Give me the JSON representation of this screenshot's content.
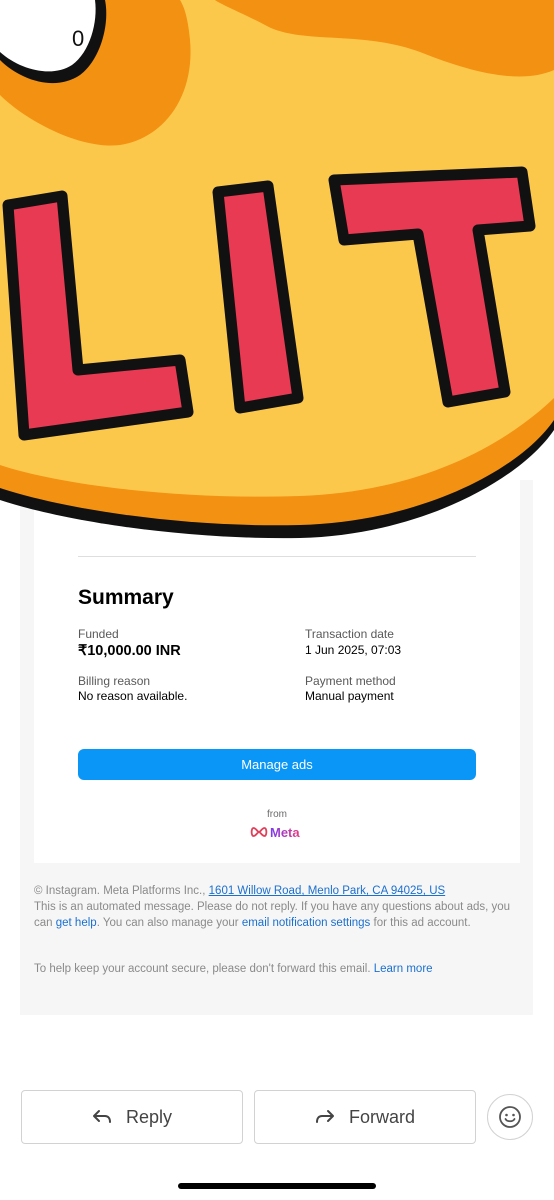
{
  "sticker": {
    "text": "LIT",
    "partial_text": "0"
  },
  "summary": {
    "title": "Summary",
    "funded_label": "Funded",
    "funded_value": "₹10,000.00 INR",
    "transaction_date_label": "Transaction date",
    "transaction_date_value": "1 Jun 2025, 07:03",
    "billing_reason_label": "Billing reason",
    "billing_reason_value": "No reason available.",
    "payment_method_label": "Payment method",
    "payment_method_value": "Manual payment"
  },
  "manage_ads_label": "Manage ads",
  "branding": {
    "from": "from",
    "logo_text": "Meta"
  },
  "footer": {
    "copyright": "© Instagram. Meta Platforms Inc.,",
    "address": "1601 Willow Road, Menlo Park, CA 94025, US",
    "automated_msg": "This is an automated message. Please do not reply. If you have any questions about ads, you can",
    "get_help": "get help",
    "manage_text": ". You can also manage your",
    "email_settings": "email notification settings",
    "ad_account_text": "for this ad account.",
    "secure_text": "To help keep your account secure, please don't forward this email.",
    "learn_more": "Learn more"
  },
  "actions": {
    "reply": "Reply",
    "forward": "Forward"
  },
  "colors": {
    "accent": "#0a96f6",
    "link": "#1b6fcf",
    "sticker_yellow": "#fcc84c",
    "sticker_orange": "#f39112",
    "sticker_red": "#e83a52"
  }
}
